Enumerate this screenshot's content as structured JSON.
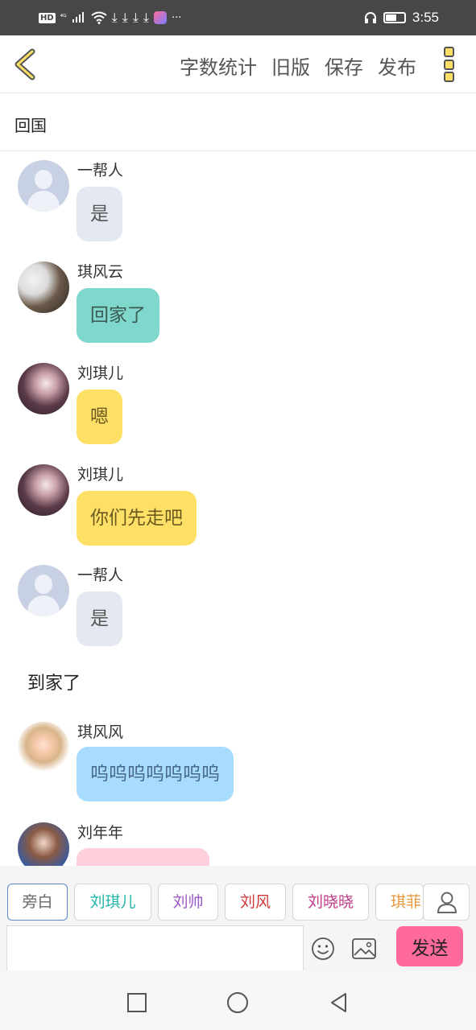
{
  "status_bar": {
    "hd": "HD",
    "signal": "⁴ᴳ",
    "more": "···",
    "time": "3:55"
  },
  "top_bar": {
    "actions": [
      "字数统计",
      "旧版",
      "保存",
      "发布"
    ]
  },
  "title": "回国",
  "messages": [
    {
      "type": "bubble",
      "name": "一帮人",
      "text": "是",
      "avatar": "default-avatar",
      "bubble_color": "#e4e8f0",
      "text_color": "#555555"
    },
    {
      "type": "bubble",
      "name": "琪风云",
      "text": "回家了",
      "avatar": "man-photo",
      "bubble_color": "#80d8cc",
      "text_color": "#3b5a54"
    },
    {
      "type": "bubble",
      "name": "刘琪儿",
      "text": "嗯",
      "avatar": "woman-photo",
      "bubble_color": "#ffe066",
      "text_color": "#6b5a20"
    },
    {
      "type": "bubble",
      "name": "刘琪儿",
      "text": "你们先走吧",
      "avatar": "woman-photo",
      "bubble_color": "#ffe066",
      "text_color": "#6b5a20"
    },
    {
      "type": "bubble",
      "name": "一帮人",
      "text": "是",
      "avatar": "default-avatar",
      "bubble_color": "#e4e8f0",
      "text_color": "#555555"
    },
    {
      "type": "narration",
      "text": "到家了"
    },
    {
      "type": "bubble",
      "name": "琪风风",
      "text": "呜呜呜呜呜呜呜",
      "avatar": "baby-photo",
      "bubble_color": "#a8dcff",
      "text_color": "#4a6a8a"
    },
    {
      "type": "bubble",
      "name": "刘年年",
      "text": "",
      "avatar": "girl-photo",
      "bubble_color": "#ffd0dc",
      "text_color": "#555555"
    }
  ],
  "roles": [
    {
      "label": "旁白",
      "color": "#666666",
      "active": true
    },
    {
      "label": "刘琪儿",
      "color": "#1fb5a8",
      "active": false
    },
    {
      "label": "刘帅",
      "color": "#9b59c6",
      "active": false
    },
    {
      "label": "刘风",
      "color": "#d23a3a",
      "active": false
    },
    {
      "label": "刘晓晓",
      "color": "#c03a8a",
      "active": false
    },
    {
      "label": "琪菲",
      "color": "#e8963a",
      "active": false
    }
  ],
  "input": {
    "value": "",
    "placeholder": ""
  },
  "send_label": "发送",
  "icons": [
    "back-chevron-icon",
    "more-vertical-icon",
    "user-icon",
    "emoji-icon",
    "image-icon",
    "nav-square-icon",
    "nav-circle-icon",
    "nav-back-triangle-icon"
  ]
}
